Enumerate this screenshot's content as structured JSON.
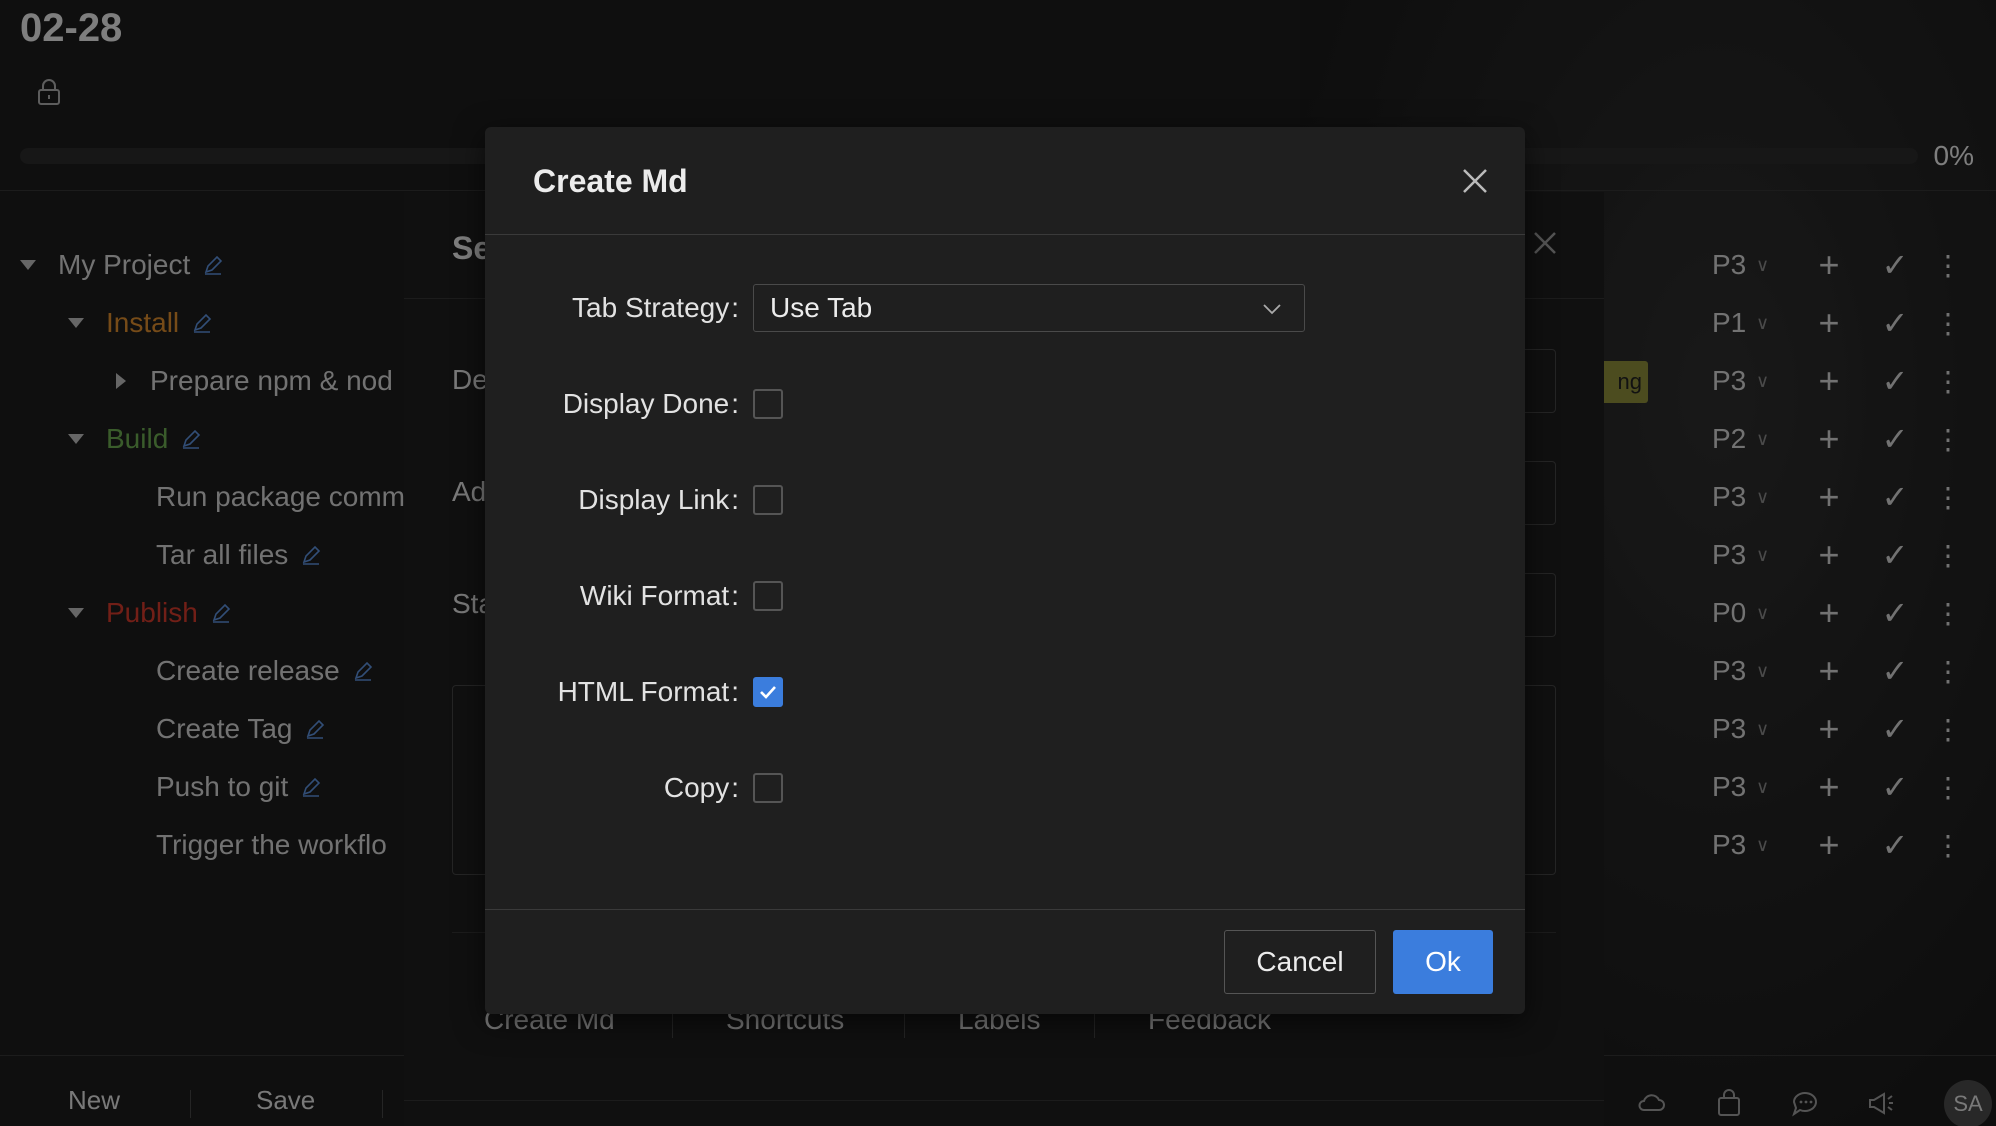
{
  "header": {
    "date": "02-28",
    "progress_percent": "0%",
    "progress_value": 0
  },
  "tree": [
    {
      "label": "My Project",
      "color": "#cfcfcf",
      "caret": "down",
      "edit": true
    },
    {
      "label": "Install",
      "color": "#d8892c",
      "caret": "down",
      "edit": true
    },
    {
      "label": "Prepare npm & nod",
      "color": "#cfcfcf",
      "caret": "right",
      "edit": false
    },
    {
      "label": "Build",
      "color": "#6aa84f",
      "caret": "down",
      "edit": true
    },
    {
      "label": "Run package comm",
      "color": "#cfcfcf",
      "caret": "none",
      "edit": false
    },
    {
      "label": "Tar all files",
      "color": "#cfcfcf",
      "caret": "none",
      "edit": true
    },
    {
      "label": "Publish",
      "color": "#d0392b",
      "caret": "down",
      "edit": true
    },
    {
      "label": "Create release",
      "color": "#cfcfcf",
      "caret": "none",
      "edit": true
    },
    {
      "label": "Create Tag",
      "color": "#cfcfcf",
      "caret": "none",
      "edit": true
    },
    {
      "label": "Push to git",
      "color": "#cfcfcf",
      "caret": "none",
      "edit": true
    },
    {
      "label": "Trigger the workflo",
      "color": "#cfcfcf",
      "caret": "none",
      "edit": false
    }
  ],
  "priorities": [
    "P3",
    "P1",
    "P3",
    "P2",
    "P3",
    "P3",
    "P0",
    "P3",
    "P3",
    "P3",
    "P3"
  ],
  "tag_chip": "ng",
  "settings": {
    "title": "Se",
    "labels": [
      "De",
      "Ad",
      "Sta"
    ],
    "links": [
      "Create Md",
      "Shortcuts",
      "Labels",
      "Feedback"
    ]
  },
  "footer": {
    "new_label": "New",
    "save_label": "Save",
    "avatar": "SA"
  },
  "modal": {
    "title": "Create Md",
    "tab_strategy": {
      "label": "Tab Strategy",
      "value": "Use Tab"
    },
    "checkboxes": [
      {
        "label": "Display Done",
        "checked": false
      },
      {
        "label": "Display Link",
        "checked": false
      },
      {
        "label": "Wiki Format",
        "checked": false
      },
      {
        "label": "HTML Format",
        "checked": true
      },
      {
        "label": "Copy",
        "checked": false
      }
    ],
    "cancel_label": "Cancel",
    "ok_label": "Ok"
  },
  "colors": {
    "accent": "#3b7ddd",
    "background": "#1c1c1c",
    "modal": "#1f1f1f"
  }
}
